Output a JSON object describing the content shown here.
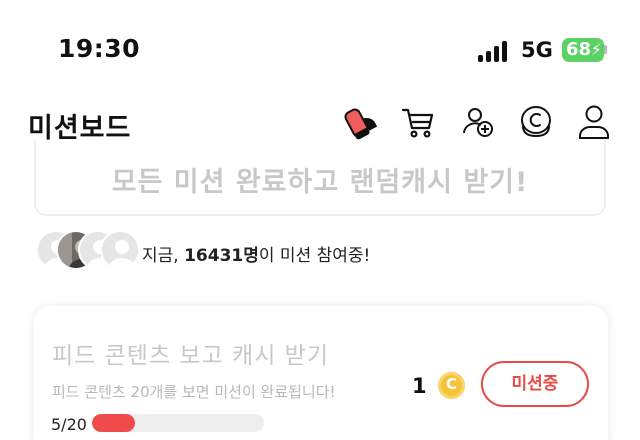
{
  "status_bar": {
    "time": "19:30",
    "network": "5G",
    "battery": "68",
    "signal_icon": "signal-bars-icon",
    "battery_color": "#5cd266"
  },
  "header": {
    "title": "미션보드",
    "icons": [
      "shoe-icon",
      "cart-icon",
      "add-friend-icon",
      "cash-coin-icon",
      "profile-icon"
    ]
  },
  "banner": {
    "text": "모든 미션 완료하고 랜덤캐시 받기!"
  },
  "participants": {
    "prefix": "지금, ",
    "count": "16431명",
    "suffix": "이 미션 참여중!"
  },
  "mission": {
    "title": "피드 콘텐츠 보고 캐시 받기",
    "description": "피드 콘텐츠 20개를 보면 미션이 완료됩니다!",
    "progress_label": "5/20",
    "progress_fraction": 0.25,
    "reward": "1",
    "reward_icon": "cash-coin-icon",
    "button_label": "미션중",
    "accent_color": "#e94a45"
  }
}
